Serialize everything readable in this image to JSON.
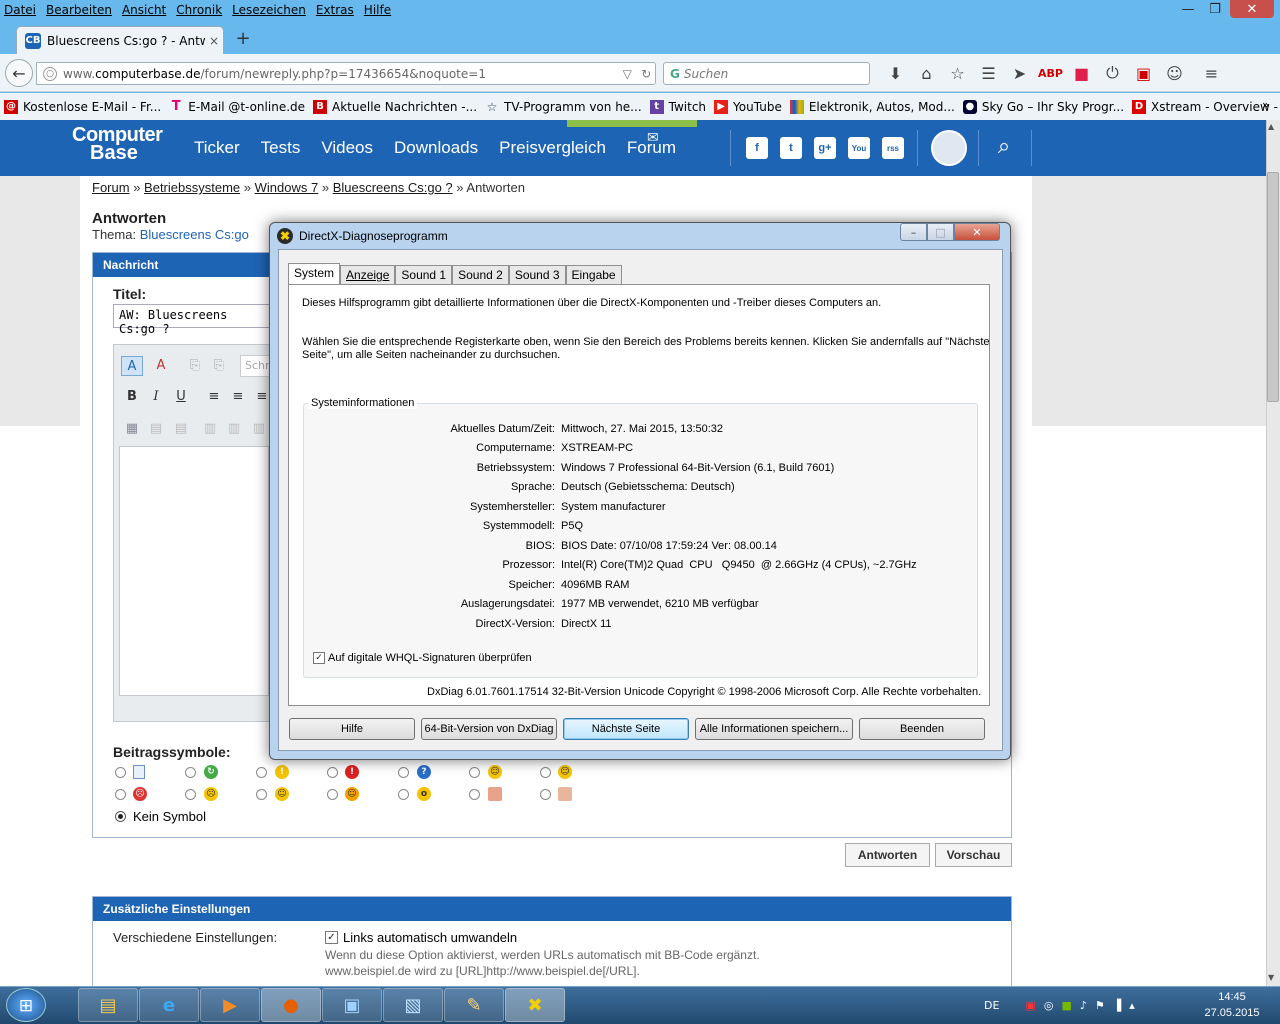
{
  "menu": [
    "Datei",
    "Bearbeiten",
    "Ansicht",
    "Chronik",
    "Lesezeichen",
    "Extras",
    "Hilfe"
  ],
  "window_controls": {
    "minimize": "—",
    "maximize": "❐",
    "close": "✕"
  },
  "tab": {
    "title": "Bluescreens Cs:go ? - Antw...",
    "favicon": "CB",
    "close": "×"
  },
  "new_tab": "+",
  "url": {
    "prefix": "www.",
    "domain": "computerbase.de",
    "path": "/forum/newreply.php?p=17436654&noquote=1"
  },
  "search": {
    "placeholder": "Suchen",
    "engine": "G"
  },
  "bookmarks": [
    {
      "label": "Kostenlose E-Mail - Fr...",
      "icon": "@",
      "color": "#c00"
    },
    {
      "label": "E-Mail @t-online.de",
      "icon": "T",
      "color": "#e20074"
    },
    {
      "label": "Aktuelle Nachrichten -...",
      "icon": "B",
      "color": "#c00"
    },
    {
      "label": "TV-Programm von he...",
      "icon": "tv",
      "color": "#234"
    },
    {
      "label": "Twitch",
      "icon": "t",
      "color": "#6441a5"
    },
    {
      "label": "YouTube",
      "icon": "▶",
      "color": "#e62117"
    },
    {
      "label": "Elektronik, Autos, Mod...",
      "icon": "e",
      "color": "#d4a000"
    },
    {
      "label": "Sky Go – Ihr Sky Progr...",
      "icon": "S",
      "color": "#003"
    },
    {
      "label": "Xstream - Overview - ...",
      "icon": "D",
      "color": "#d00"
    }
  ],
  "site": {
    "logo_line1": "Computer",
    "logo_line2": "Base",
    "nav": [
      "Ticker",
      "Tests",
      "Videos",
      "Downloads",
      "Preisvergleich",
      "Forum"
    ],
    "social": [
      "f",
      "t",
      "g+",
      "You",
      "rss"
    ]
  },
  "breadcrumb": {
    "items": [
      "Forum",
      "Betriebssysteme",
      "Windows 7",
      "Bluescreens Cs:go ?"
    ],
    "current": "Antworten",
    "sep": "»"
  },
  "reply": {
    "heading": "Antworten",
    "thema_label": "Thema:",
    "thema_value": "Bluescreens Cs:go",
    "nachricht_header": "Nachricht",
    "titel_label": "Titel:",
    "titel_value": "AW: Bluescreens Cs:go ?",
    "schrift_placeholder": "Schr",
    "beitragssymbole_label": "Beitragssymbole:",
    "kein_symbol": "Kein Symbol",
    "btn_antworten": "Antworten",
    "btn_vorschau": "Vorschau"
  },
  "zusaetzliche": {
    "header": "Zusätzliche Einstellungen",
    "label": "Verschiedene Einstellungen:",
    "checkbox_label": "Links automatisch umwandeln",
    "hint1": "Wenn du diese Option aktivierst, werden URLs automatisch mit BB-Code ergänzt.",
    "hint2": "www.beispiel.de wird zu [URL]http://www.beispiel.de[/URL]."
  },
  "dxdiag": {
    "title": "DirectX-Diagnoseprogramm",
    "tabs": [
      "System",
      "Anzeige",
      "Sound 1",
      "Sound 2",
      "Sound 3",
      "Eingabe"
    ],
    "intro1": "Dieses Hilfsprogramm gibt detaillierte Informationen über die DirectX-Komponenten und -Treiber dieses Computers an.",
    "intro2a": "Wählen Sie die entsprechende Registerkarte oben, wenn Sie den Bereich des Problems bereits kennen. Klicken Sie andernfalls auf \"Nächste",
    "intro2b": "Seite\", um alle Seiten nacheinander zu durchsuchen.",
    "group_label": "Systeminformationen",
    "rows": [
      {
        "label": "Aktuelles Datum/Zeit:",
        "value": "Mittwoch, 27. Mai 2015, 13:50:32"
      },
      {
        "label": "Computername:",
        "value": "XSTREAM-PC"
      },
      {
        "label": "Betriebssystem:",
        "value": "Windows 7 Professional 64-Bit-Version (6.1, Build 7601)"
      },
      {
        "label": "Sprache:",
        "value": "Deutsch (Gebietsschema: Deutsch)"
      },
      {
        "label": "Systemhersteller:",
        "value": "System manufacturer"
      },
      {
        "label": "Systemmodell:",
        "value": "P5Q"
      },
      {
        "label": "BIOS:",
        "value": "BIOS Date: 07/10/08 17:59:24 Ver: 08.00.14"
      },
      {
        "label": "Prozessor:",
        "value": "Intel(R) Core(TM)2 Quad  CPU   Q9450  @ 2.66GHz (4 CPUs), ~2.7GHz"
      },
      {
        "label": "Speicher:",
        "value": "4096MB RAM"
      },
      {
        "label": "Auslagerungsdatei:",
        "value": "1977 MB verwendet, 6210 MB verfügbar"
      },
      {
        "label": "DirectX-Version:",
        "value": "DirectX 11"
      }
    ],
    "whql": "Auf digitale WHQL-Signaturen überprüfen",
    "copyright": "DxDiag 6.01.7601.17514 32-Bit-Version Unicode Copyright © 1998-2006 Microsoft Corp. Alle Rechte vorbehalten.",
    "buttons": {
      "hilfe": "Hilfe",
      "bit64": "64-Bit-Version von DxDiag",
      "naechste": "Nächste Seite",
      "speichern": "Alle Informationen speichern...",
      "beenden": "Beenden"
    }
  },
  "taskbar": {
    "lang": "DE",
    "time": "14:45",
    "date": "27.05.2015"
  }
}
